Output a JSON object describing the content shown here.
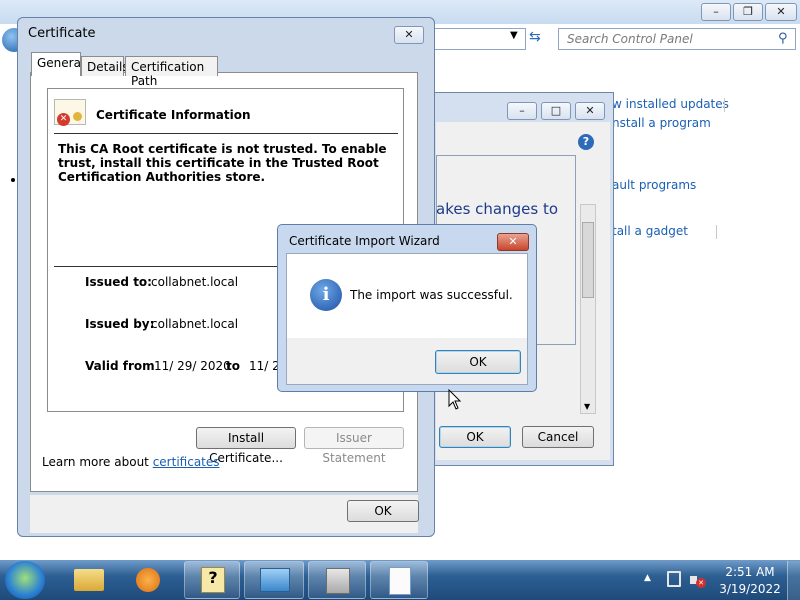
{
  "control_panel": {
    "search_placeholder": "Search Control Panel",
    "links": [
      "w installed updates",
      "nstall a program",
      "ault programs",
      "tall a gadget"
    ],
    "window_buttons": [
      "–",
      "❐",
      "✕"
    ]
  },
  "background_window": {
    "partial_text": "akes changes to",
    "ok_label": "OK",
    "cancel_label": "Cancel",
    "help_icon": "?",
    "window_buttons": [
      "–",
      "□",
      "✕"
    ]
  },
  "certificate_dialog": {
    "title": "Certificate",
    "close_glyph": "✕",
    "tabs": [
      "General",
      "Details",
      "Certification Path"
    ],
    "info_heading": "Certificate Information",
    "warning": "This CA Root certificate is not trusted. To enable trust, install this certificate in the Trusted Root Certification Authorities store.",
    "issued_to_label": "Issued to:",
    "issued_to_value": "collabnet.local",
    "issued_by_label": "Issued by:",
    "issued_by_value": "collabnet.local",
    "valid_from_label": "Valid from",
    "valid_from_value": "11/ 29/ 2020",
    "to_label": "to",
    "valid_to_value": "11/ 2",
    "install_button": "Install Certificate...",
    "issuer_statement_button": "Issuer Statement",
    "learn_more_text": "Learn more about",
    "learn_more_link": "certificates",
    "ok_button": "OK"
  },
  "import_wizard": {
    "title": "Certificate Import Wizard",
    "close_glyph": "✕",
    "message": "The import was successful.",
    "info_glyph": "i",
    "ok_button": "OK"
  },
  "taskbar": {
    "time": "2:51 AM",
    "date": "3/19/2022",
    "tray_arrow": "▲"
  }
}
